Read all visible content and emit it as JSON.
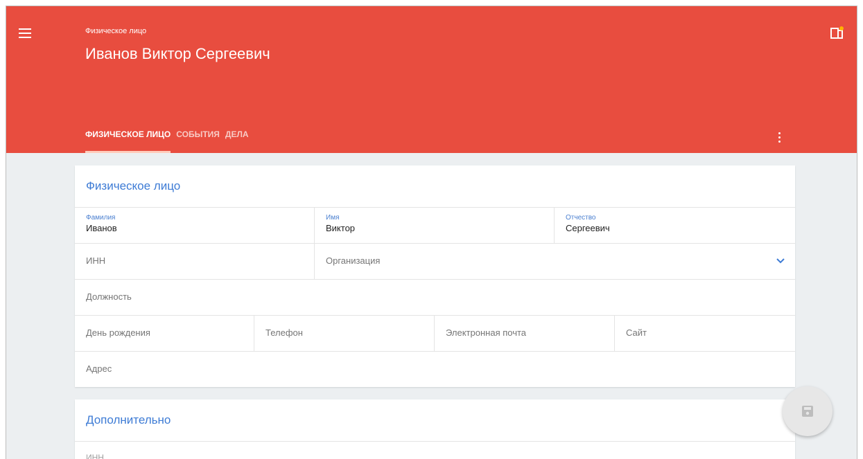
{
  "header": {
    "subtitle": "Физическое лицо",
    "title": "Иванов Виктор Сергеевич",
    "brand_color": "#e84d3f",
    "menu_icon": "menu-icon",
    "app_icon": "document-icon"
  },
  "tabs": [
    {
      "label": "Физическое лицо",
      "active": true
    },
    {
      "label": "События",
      "active": false
    },
    {
      "label": "Дела",
      "active": false
    }
  ],
  "card1": {
    "title": "Физическое лицо",
    "surname": {
      "label": "Фамилия",
      "value": "Иванов"
    },
    "name": {
      "label": "Имя",
      "value": "Виктор"
    },
    "patronymic": {
      "label": "Отчество",
      "value": "Сергеевич"
    },
    "inn": {
      "placeholder": "ИНН"
    },
    "organization": {
      "placeholder": "Организация"
    },
    "position": {
      "placeholder": "Должность"
    },
    "birthday": {
      "placeholder": "День рождения"
    },
    "phone": {
      "placeholder": "Телефон"
    },
    "email": {
      "placeholder": "Электронная почта"
    },
    "site": {
      "placeholder": "Сайт"
    },
    "address": {
      "placeholder": "Адрес"
    }
  },
  "card2": {
    "title": "Дополнительно",
    "first_field": "ИНН"
  },
  "fab": {
    "icon": "save-icon"
  }
}
